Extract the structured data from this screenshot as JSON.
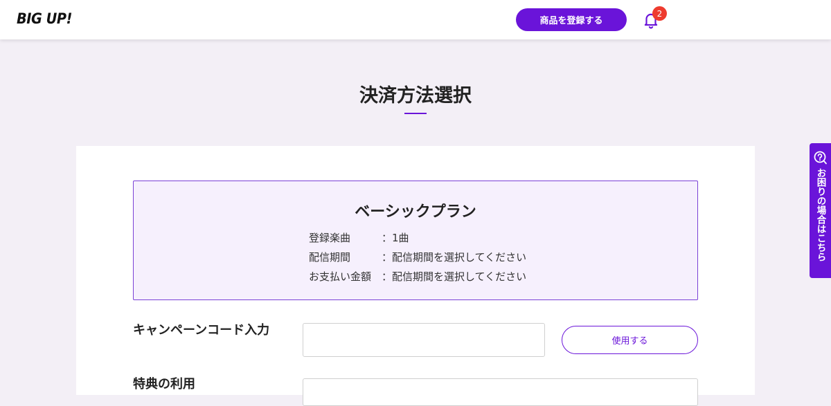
{
  "header": {
    "logo_text": "BIG UP!",
    "register_button": "商品を登録する",
    "notification_count": "2",
    "bell_icon": "bell-icon"
  },
  "page": {
    "title": "決済方法選択"
  },
  "plan": {
    "title": "ベーシックプラン",
    "rows": [
      {
        "label": "登録楽曲",
        "value": "：1曲"
      },
      {
        "label": "配信期間",
        "value": "：配信期間を選択してください"
      },
      {
        "label": "お支払い金額",
        "value": "：配信期間を選択してください"
      }
    ]
  },
  "campaign": {
    "label": "キャンペーンコード入力",
    "input_value": "",
    "use_button": "使用する"
  },
  "next_section": {
    "label": "特典の利用"
  },
  "help_tab": {
    "label": "お困りの場合はこちら",
    "icon": "question-icon"
  },
  "colors": {
    "accent": "#6a14d9",
    "badge": "#ee3b2e",
    "page_bg": "#f3eff6",
    "plan_bg": "#f6f0fd"
  }
}
